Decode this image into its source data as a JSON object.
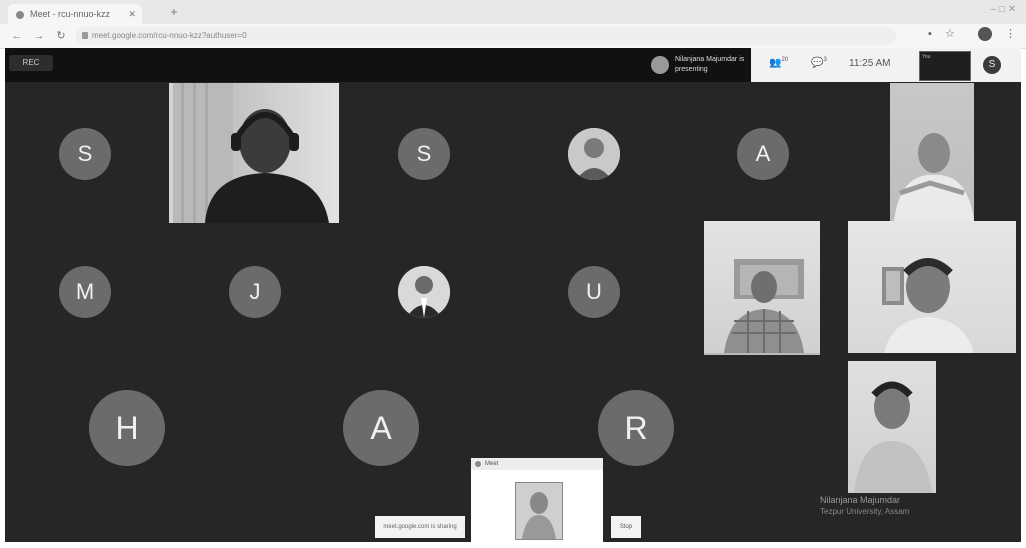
{
  "browser": {
    "tab_title": "Meet - rcu-nnuo-kzz",
    "url": "meet.google.com/rcu-nnuo-kzz?authuser=0",
    "new_tab": "+",
    "window_controls": "–  □  ✕"
  },
  "meet": {
    "recording_label": "REC",
    "presenter_name": "Nilanjana Majumdar is presenting",
    "participant_count": "20",
    "chat_count": "3",
    "time": "11:25 AM",
    "self_view_label": "You",
    "account_initial": "S"
  },
  "participants": {
    "row1": [
      "S",
      "S",
      "A"
    ],
    "row2": [
      "M",
      "J",
      "U"
    ],
    "row3": [
      "H",
      "A",
      "R"
    ]
  },
  "chat_popup": {
    "title": "Meet"
  },
  "presentation": {
    "share_label": "meet.google.com is sharing",
    "stop_label": "Stop"
  },
  "caption": {
    "name": "Nilanjana Majumdar",
    "institution": "Tezpur University, Assam"
  }
}
